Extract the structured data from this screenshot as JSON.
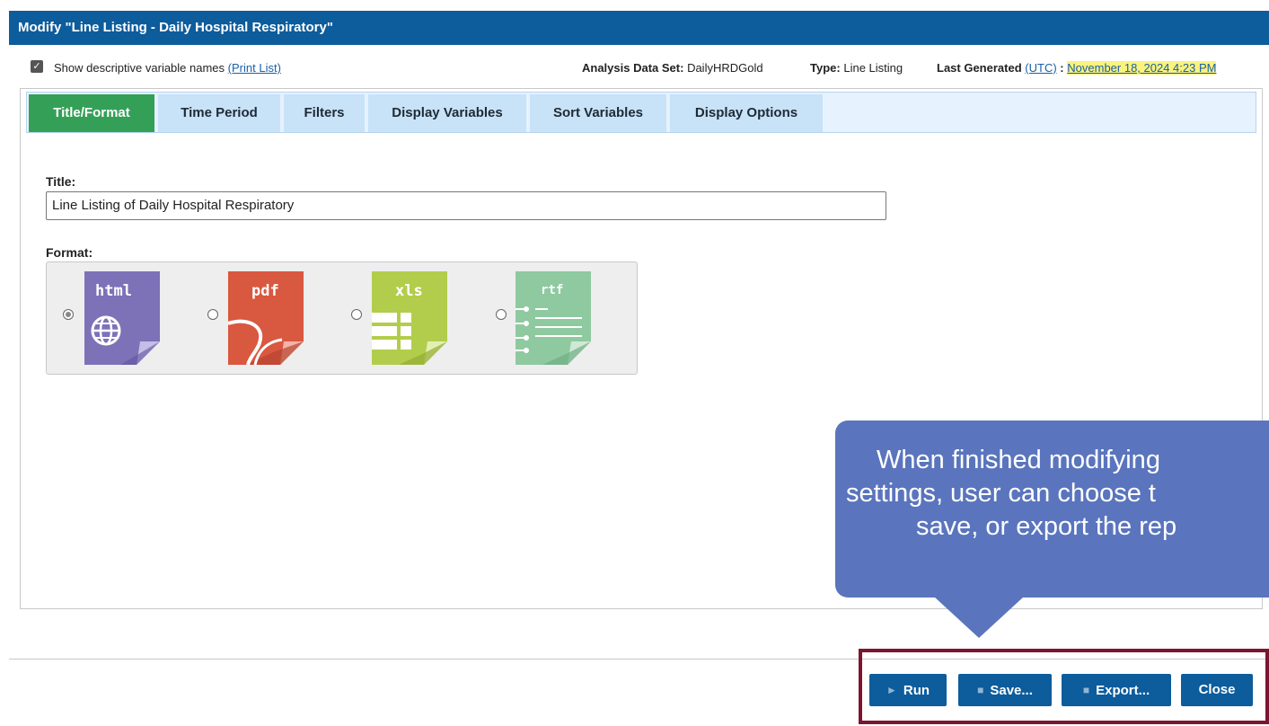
{
  "window": {
    "title": "Modify \"Line Listing - Daily Hospital Respiratory\""
  },
  "infobar": {
    "show_descriptive_label": "Show descriptive variable names",
    "print_list_link": "(Print List)",
    "analysis_label": "Analysis Data Set:",
    "analysis_value": "DailyHRDGold",
    "type_label": "Type:",
    "type_value": "Line Listing",
    "last_generated_label": "Last Generated",
    "utc_link": "(UTC)",
    "colon": ":",
    "last_generated_value": "November 18, 2024 4:23 PM",
    "checkbox_checked": true
  },
  "tabs": [
    {
      "label": "Title/Format",
      "active": true
    },
    {
      "label": "Time Period"
    },
    {
      "label": "Filters"
    },
    {
      "label": "Display Variables"
    },
    {
      "label": "Sort Variables"
    },
    {
      "label": "Display Options"
    }
  ],
  "form": {
    "title_label": "Title:",
    "title_value": "Line Listing of Daily Hospital Respiratory",
    "format_label": "Format:",
    "formats": [
      {
        "name": "html",
        "selected": true,
        "color": "#7d72b8"
      },
      {
        "name": "pdf",
        "selected": false,
        "color": "#d95840"
      },
      {
        "name": "xls",
        "selected": false,
        "color": "#b2cd4b"
      },
      {
        "name": "rtf",
        "selected": false,
        "color": "#8fc9a0"
      }
    ]
  },
  "callout": {
    "line1": "When finished modifying",
    "line2": "settings, user can choose t",
    "line3": "save, or export the rep",
    "color": "#5a75bd"
  },
  "buttons": {
    "run": "Run",
    "save": "Save...",
    "export": "Export...",
    "close": "Close"
  },
  "colors": {
    "titlebar": "#0d5c9c",
    "active_tab": "#34a057",
    "highlight_box": "#7b1530"
  }
}
